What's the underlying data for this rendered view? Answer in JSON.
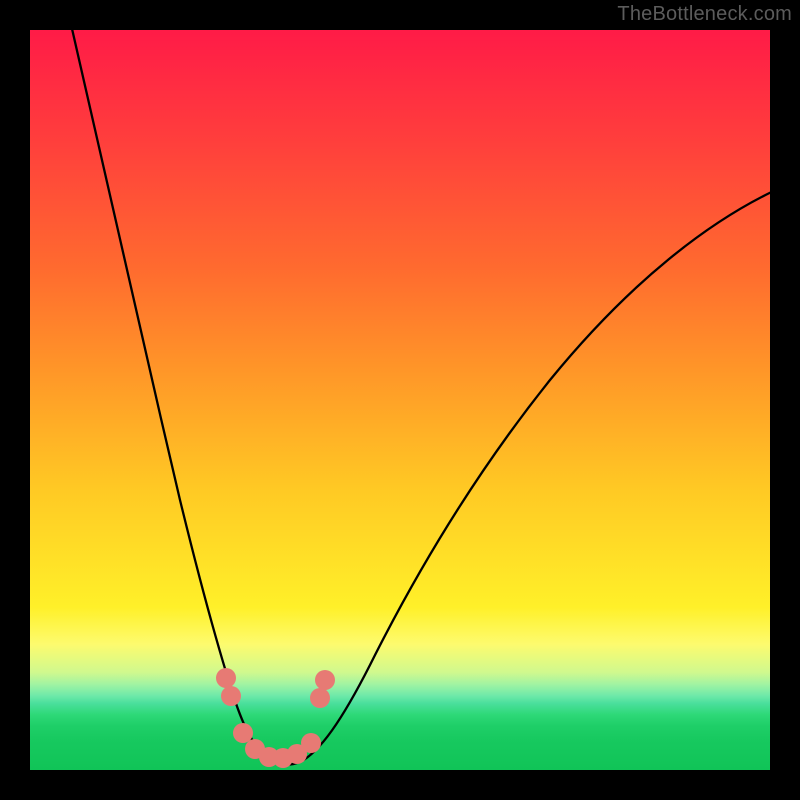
{
  "attribution": "TheBottleneck.com",
  "chart_data": {
    "type": "line",
    "title": "",
    "xlabel": "",
    "ylabel": "",
    "x_range": [
      0,
      100
    ],
    "y_range": [
      0,
      100
    ],
    "gradient_bands": [
      {
        "region": "top",
        "meaning": "high-bottleneck",
        "color": "#ff1b47"
      },
      {
        "region": "middle",
        "meaning": "moderate",
        "color": "#ffd028"
      },
      {
        "region": "bottom",
        "meaning": "optimal",
        "color": "#17c95f"
      }
    ],
    "series": [
      {
        "name": "bottleneck-curve",
        "x": [
          5,
          8,
          12,
          16,
          20,
          23,
          26,
          28,
          30,
          31.5,
          33,
          35,
          37,
          40,
          44,
          50,
          58,
          68,
          80,
          92,
          100
        ],
        "y": [
          100,
          88,
          73,
          57,
          42,
          29,
          18,
          10,
          4,
          1,
          0,
          0,
          1,
          4,
          10,
          20,
          33,
          46,
          58,
          67,
          72
        ]
      }
    ],
    "markers": {
      "name": "highlighted-range",
      "color": "#e77a74",
      "points": [
        {
          "x": 27.0,
          "y": 10.0
        },
        {
          "x": 27.6,
          "y": 7.2
        },
        {
          "x": 29.2,
          "y": 2.4
        },
        {
          "x": 30.8,
          "y": 0.9
        },
        {
          "x": 32.6,
          "y": 0.5
        },
        {
          "x": 34.6,
          "y": 0.7
        },
        {
          "x": 36.6,
          "y": 1.6
        },
        {
          "x": 38.4,
          "y": 3.4
        },
        {
          "x": 39.4,
          "y": 8.1
        },
        {
          "x": 40.1,
          "y": 10.8
        }
      ]
    },
    "minimum_at_x": 33
  }
}
